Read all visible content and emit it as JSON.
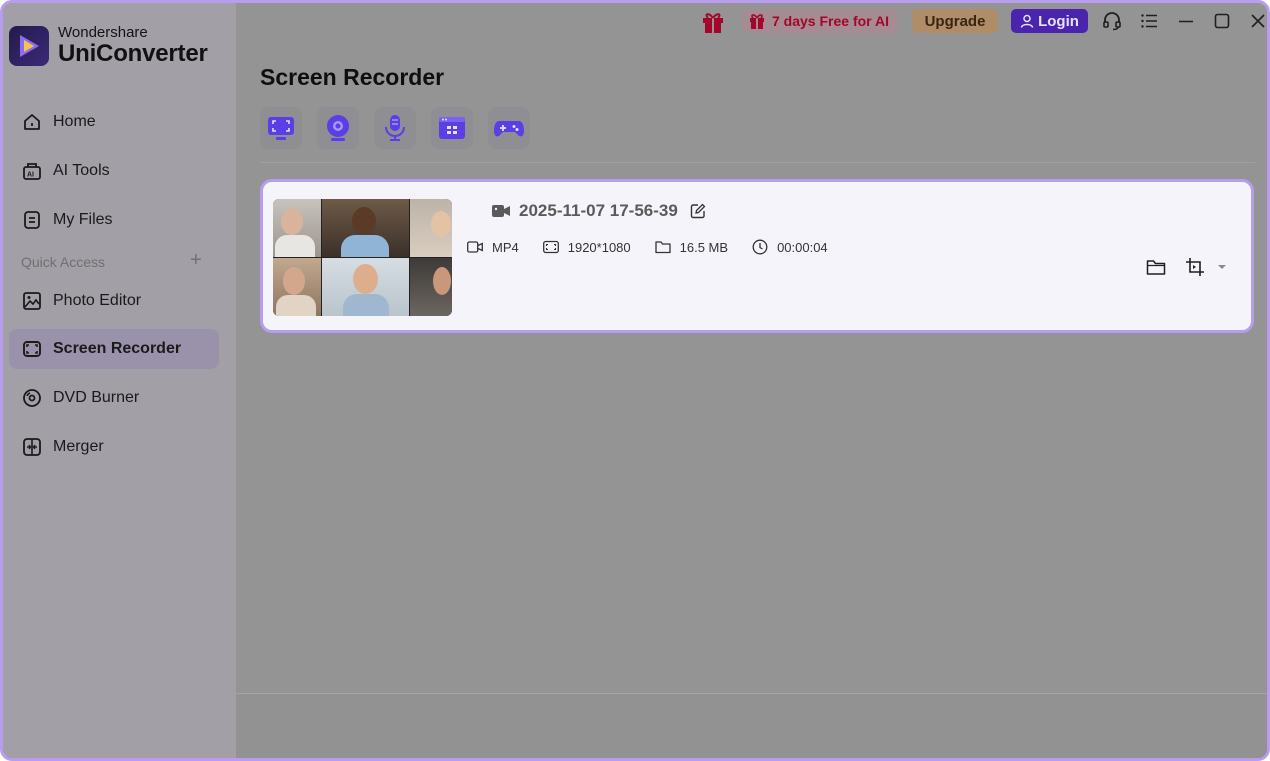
{
  "app": {
    "brand_top": "Wondershare",
    "brand_main": "UniConverter"
  },
  "topbar": {
    "promo_label": "7 days Free for AI",
    "upgrade_label": "Upgrade",
    "login_label": "Login"
  },
  "sidebar": {
    "items": [
      {
        "label": "Home",
        "icon": "home-icon"
      },
      {
        "label": "AI Tools",
        "icon": "ai-tools-icon"
      },
      {
        "label": "My Files",
        "icon": "files-icon"
      }
    ],
    "quick_access_label": "Quick Access",
    "quick_items": [
      {
        "label": "Photo Editor",
        "icon": "photo-editor-icon"
      },
      {
        "label": "Screen Recorder",
        "icon": "screen-recorder-icon",
        "active": true
      },
      {
        "label": "DVD Burner",
        "icon": "dvd-icon"
      },
      {
        "label": "Merger",
        "icon": "merger-icon"
      }
    ]
  },
  "main": {
    "title": "Screen Recorder",
    "modes": [
      "screen-mode-icon",
      "webcam-mode-icon",
      "audio-mode-icon",
      "app-window-mode-icon",
      "game-mode-icon"
    ],
    "recording": {
      "name": "2025-11-07 17-56-39",
      "format": "MP4",
      "resolution": "1920*1080",
      "size": "16.5 MB",
      "duration": "00:00:04"
    }
  },
  "colors": {
    "accent": "#b79cf0",
    "login_bg": "#4a24ad",
    "upgrade_bg": "#ae8d68",
    "promo_text": "#a3062a"
  }
}
